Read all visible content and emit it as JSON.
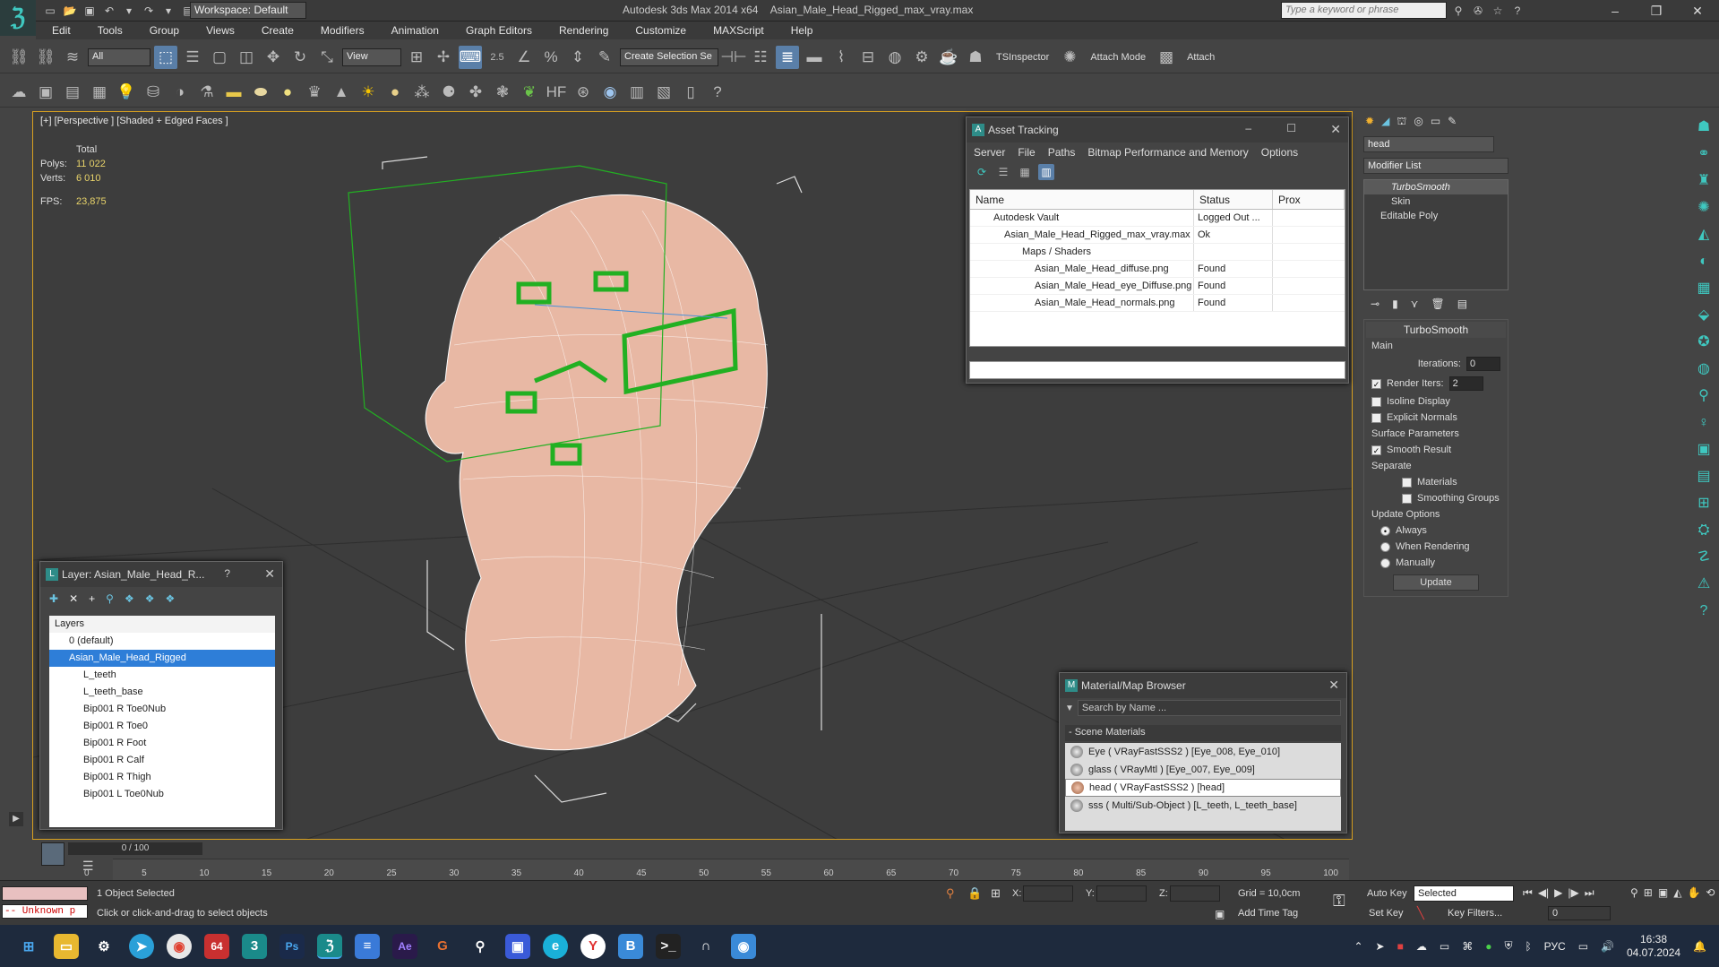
{
  "titlebar": {
    "app_title": "Autodesk 3ds Max  2014 x64",
    "file_title": "Asian_Male_Head_Rigged_max_vray.max",
    "workspace": "Workspace: Default",
    "search_placeholder": "Type a keyword or phrase"
  },
  "menu": [
    "Edit",
    "Tools",
    "Group",
    "Views",
    "Create",
    "Modifiers",
    "Animation",
    "Graph Editors",
    "Rendering",
    "Customize",
    "MAXScript",
    "Help"
  ],
  "toolbar": {
    "filter": "All",
    "view": "View",
    "angle_snap": "2.5",
    "selection_set": "Create Selection Se",
    "tsinspector": "TSInspector",
    "attach_mode": "Attach Mode",
    "attach": "Attach"
  },
  "viewport": {
    "label": "[+] [Perspective ] [Shaded + Edged Faces ]",
    "stats": {
      "total_label": "Total",
      "polys_label": "Polys:",
      "polys": "11 022",
      "verts_label": "Verts:",
      "verts": "6 010",
      "fps_label": "FPS:",
      "fps": "23,875"
    }
  },
  "asset_tracking": {
    "title": "Asset Tracking",
    "menu": [
      "Server",
      "File",
      "Paths",
      "Bitmap Performance and Memory",
      "Options"
    ],
    "columns": [
      "Name",
      "Status",
      "Prox"
    ],
    "rows": [
      {
        "name": "Autodesk Vault",
        "status": "Logged Out ..."
      },
      {
        "name": "Asian_Male_Head_Rigged_max_vray.max",
        "status": "Ok"
      },
      {
        "name": "Maps / Shaders",
        "status": ""
      },
      {
        "name": "Asian_Male_Head_diffuse.png",
        "status": "Found"
      },
      {
        "name": "Asian_Male_Head_eye_Diffuse.png",
        "status": "Found"
      },
      {
        "name": "Asian_Male_Head_normals.png",
        "status": "Found"
      }
    ]
  },
  "layer_dialog": {
    "title": "Layer: Asian_Male_Head_R...",
    "help": "?",
    "header": "Layers",
    "items": [
      "0 (default)",
      "Asian_Male_Head_Rigged",
      "L_teeth",
      "L_teeth_base",
      "Bip001 R Toe0Nub",
      "Bip001 R Toe0",
      "Bip001 R Foot",
      "Bip001 R Calf",
      "Bip001 R Thigh",
      "Bip001 L Toe0Nub"
    ]
  },
  "material_browser": {
    "title": "Material/Map Browser",
    "search_placeholder": "Search by Name ...",
    "group": "- Scene Materials",
    "items": [
      "Eye  ( VRayFastSSS2 ) [Eye_008, Eye_010]",
      "glass  ( VRayMtl ) [Eye_007, Eye_009]",
      "head  ( VRayFastSSS2 ) [head]",
      "sss  ( Multi/Sub-Object ) [L_teeth, L_teeth_base]"
    ]
  },
  "command_panel": {
    "object_name": "head",
    "modifier_list": "Modifier List",
    "stack": [
      "TurboSmooth",
      "Skin",
      "Editable Poly"
    ],
    "turbosmooth": {
      "title": "TurboSmooth",
      "main": "Main",
      "iterations_label": "Iterations:",
      "iterations": "0",
      "render_iters_label": "Render Iters:",
      "render_iters": "2",
      "isoline": "Isoline Display",
      "explicit": "Explicit Normals",
      "surface": "Surface Parameters",
      "smooth_result": "Smooth Result",
      "separate": "Separate",
      "materials": "Materials",
      "smoothing_groups": "Smoothing Groups",
      "update_options": "Update Options",
      "always": "Always",
      "when_rendering": "When Rendering",
      "manually": "Manually",
      "update": "Update"
    }
  },
  "timeline": {
    "frame": "0 / 100",
    "ticks": [
      "0",
      "5",
      "10",
      "15",
      "20",
      "25",
      "30",
      "35",
      "40",
      "45",
      "50",
      "55",
      "60",
      "65",
      "70",
      "75",
      "80",
      "85",
      "90",
      "95",
      "100"
    ]
  },
  "status": {
    "unknown": "-- Unknown p",
    "selected": "1 Object Selected",
    "prompt": "Click or click-and-drag to select objects",
    "x_label": "X:",
    "y_label": "Y:",
    "z_label": "Z:",
    "grid": "Grid = 10,0cm",
    "add_time_tag": "Add Time Tag",
    "auto_key": "Auto Key",
    "set_key": "Set Key",
    "selected_dd": "Selected",
    "key_filters": "Key Filters...",
    "frame_field": "0"
  },
  "taskbar": {
    "lang": "РУС",
    "time": "16:38",
    "date": "04.07.2024",
    "badge": "64"
  },
  "colors": {
    "accent": "#3fc8c0",
    "selection_green": "#22b022",
    "viewport_border": "#d8a020",
    "skin": "#e8b8a4"
  }
}
